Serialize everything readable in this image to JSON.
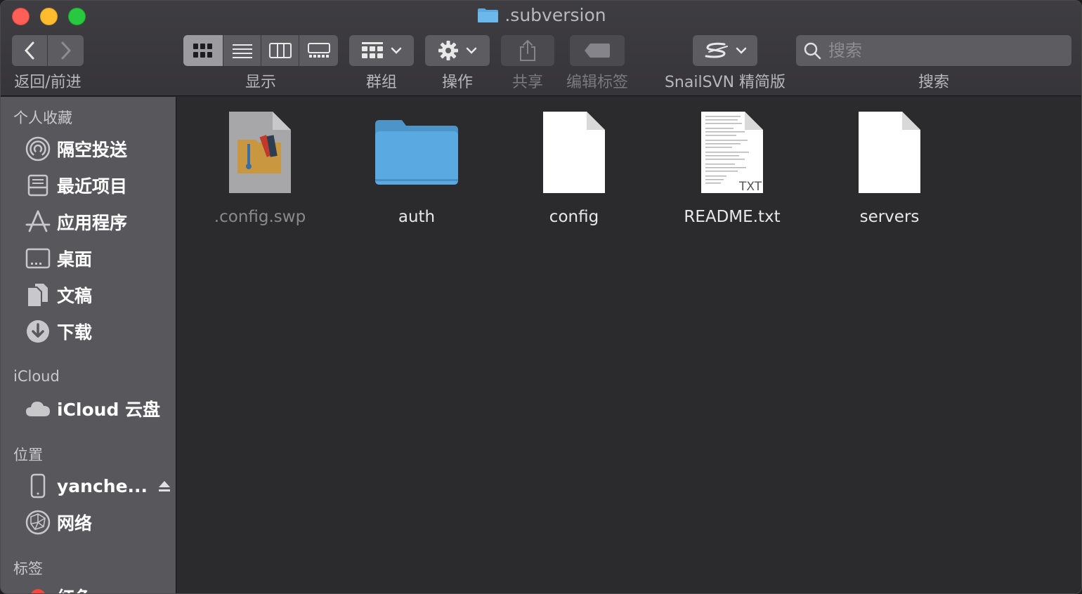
{
  "window": {
    "title": ".subversion"
  },
  "toolbar": {
    "nav_label": "返回/前进",
    "view_label": "显示",
    "group_label": "群组",
    "action_label": "操作",
    "share_label": "共享",
    "tags_label": "编辑标签",
    "plugin_label": "SnailSVN 精简版",
    "search_label": "搜索",
    "search_placeholder": "搜索"
  },
  "sidebar": {
    "favorites_title": "个人收藏",
    "favorites": [
      {
        "label": "隔空投送",
        "icon": "airdrop-icon"
      },
      {
        "label": "最近项目",
        "icon": "recents-icon"
      },
      {
        "label": "应用程序",
        "icon": "applications-icon"
      },
      {
        "label": "桌面",
        "icon": "desktop-icon"
      },
      {
        "label": "文稿",
        "icon": "documents-icon"
      },
      {
        "label": "下载",
        "icon": "downloads-icon"
      }
    ],
    "icloud_title": "iCloud",
    "icloud": [
      {
        "label": "iCloud 云盘",
        "icon": "cloud-icon"
      }
    ],
    "locations_title": "位置",
    "locations": [
      {
        "label": "yanche...",
        "icon": "iphone-icon"
      },
      {
        "label": "网络",
        "icon": "network-icon"
      }
    ],
    "tags_title": "标签",
    "tags": [
      {
        "label": "红色",
        "color": "#ff453a"
      }
    ]
  },
  "files": [
    {
      "name": ".config.swp",
      "icon": "swp-file-icon",
      "hidden": true
    },
    {
      "name": "auth",
      "icon": "folder-icon",
      "hidden": false
    },
    {
      "name": "config",
      "icon": "blank-file-icon",
      "hidden": false
    },
    {
      "name": "README.txt",
      "icon": "txt-file-icon",
      "hidden": false,
      "badge": "TXT"
    },
    {
      "name": "servers",
      "icon": "blank-file-icon",
      "hidden": false
    }
  ],
  "colors": {
    "accent_folder": "#5aa9e0",
    "sidebar_bg": "#58575c",
    "content_bg": "#2b2b2d"
  }
}
